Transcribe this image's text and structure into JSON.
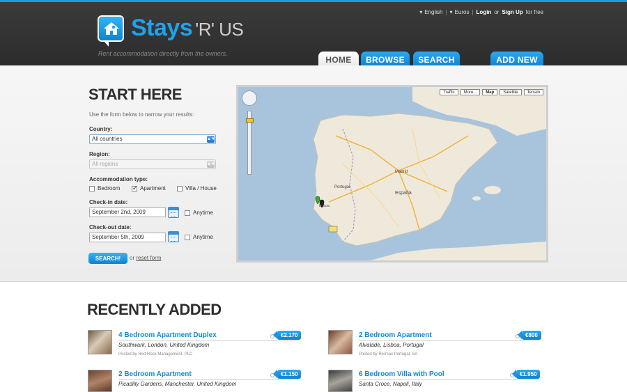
{
  "header": {
    "logo_main": "Stays",
    "logo_suffix": "'R' US",
    "tagline": "Rent accommodation directly from the owners.",
    "language": "English",
    "currency": "Euros",
    "login": "Login",
    "or": "or",
    "signup": "Sign Up",
    "for_free": "for free",
    "nav": [
      "HOME",
      "BROWSE",
      "SEARCH",
      "ADD NEW"
    ],
    "active_tab": "HOME"
  },
  "search": {
    "title": "START HERE",
    "intro": "Use the form below to narrow your results:",
    "country_label": "Country:",
    "country_value": "All countries",
    "region_label": "Region:",
    "region_value": "All regions",
    "accom_label": "Accommodation type:",
    "accom_options": [
      {
        "label": "Bedroom",
        "checked": false
      },
      {
        "label": "Apartment",
        "checked": true
      },
      {
        "label": "Villa / House",
        "checked": false
      }
    ],
    "checkin_label": "Check-in date:",
    "checkin_value": "September 2nd, 2009",
    "checkout_label": "Check-out date:",
    "checkout_value": "September 5th, 2009",
    "anytime": "Anytime",
    "search_button": "SEARCH!",
    "or": "or",
    "reset": "reset form"
  },
  "map": {
    "buttons": [
      "Traffic",
      "More...",
      "Map",
      "Satellite",
      "Terrain"
    ],
    "active": "Map",
    "label_country": "España",
    "label_portugal": "Portugal",
    "label_madrid": "Madrid",
    "label_lisboa": "Lisboa"
  },
  "recent": {
    "title": "RECENTLY ADDED",
    "listings": [
      {
        "title": "4 Bedroom Apartment Duplex",
        "location": "Southwark, London, United Kingdom",
        "posted": "Posted by Red Rock Management, PLC",
        "price": "€2.170"
      },
      {
        "title": "2 Bedroom Apartment",
        "location": "Alvalade, Lisboa, Portugal",
        "posted": "Posted by Re/max Portugal, SA",
        "price": "€800"
      },
      {
        "title": "2 Bedroom Apartment",
        "location": "Picadilly Gardens, Manchester, United Kingdom",
        "posted": "",
        "price": "€1.150"
      },
      {
        "title": "6 Bedroom Villa with Pool",
        "location": "Santa Croce, Napoli, Italy",
        "posted": "",
        "price": "€1.950"
      }
    ]
  },
  "colors": {
    "accent": "#1288d4",
    "header": "#333333"
  }
}
